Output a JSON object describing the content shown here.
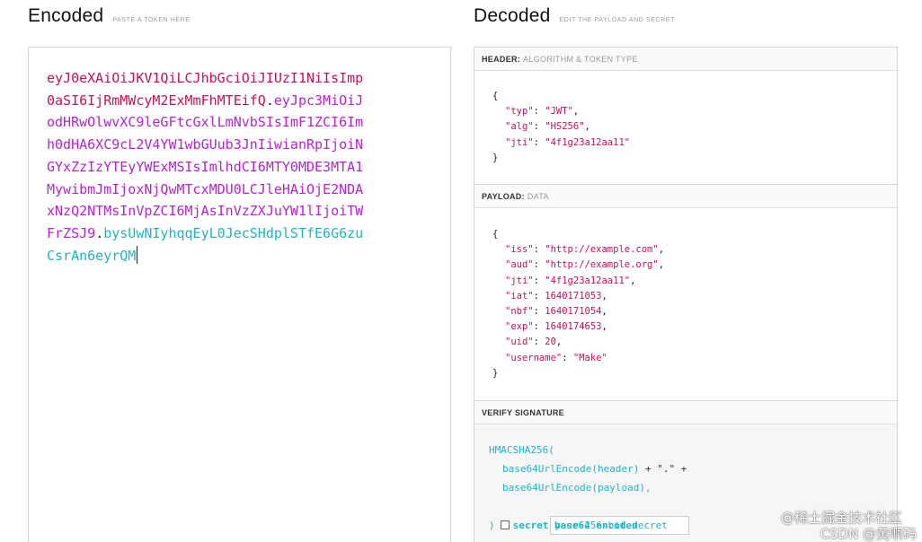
{
  "encoded": {
    "title": "Encoded",
    "hint": "PASTE A TOKEN HERE",
    "token_lines": [
      [
        {
          "t": "eyJ0eXAiOiJKV1QiLCJhbGciOiJIUzI1NiIsImp",
          "c": "header"
        }
      ],
      [
        {
          "t": "0aSI6IjRmMWcyM2ExMmFhMTEifQ",
          "c": "header"
        },
        {
          "t": ".",
          "c": "dot"
        },
        {
          "t": "eyJpc3MiOiJ",
          "c": "payload"
        }
      ],
      [
        {
          "t": "odHRwOlwvXC9leGFtcGxlLmNvbSIsImF1ZCI6Im",
          "c": "payload"
        }
      ],
      [
        {
          "t": "h0dHA6XC9cL2V4YW1wbGUub3JnIiwianRpIjoiN",
          "c": "payload"
        }
      ],
      [
        {
          "t": "GYxZzIzYTEyYWExMSIsImlhdCI6MTY0MDE3MTA1",
          "c": "payload"
        }
      ],
      [
        {
          "t": "MywibmJmIjoxNjQwMTcxMDU0LCJleHAiOjE2NDA",
          "c": "payload"
        }
      ],
      [
        {
          "t": "xNzQ2NTMsInVpZCI6MjAsInVzZXJuYW1lIjoiTW",
          "c": "payload"
        }
      ],
      [
        {
          "t": "FrZSJ9",
          "c": "payload"
        },
        {
          "t": ".",
          "c": "dot"
        },
        {
          "t": "bysUwNIyhqqEyL0JecSHdplSTfE6G6zu",
          "c": "sig"
        }
      ],
      [
        {
          "t": "CsrAn6eyrQM",
          "c": "sig"
        }
      ]
    ]
  },
  "decoded": {
    "title": "Decoded",
    "hint": "EDIT THE PAYLOAD AND SECRET",
    "header_section": {
      "label": "HEADER:",
      "sub": "ALGORITHM & TOKEN TYPE",
      "fields": [
        {
          "key": "typ",
          "value": "\"JWT\""
        },
        {
          "key": "alg",
          "value": "\"HS256\""
        },
        {
          "key": "jti",
          "value": "\"4f1g23a12aa11\""
        }
      ]
    },
    "payload_section": {
      "label": "PAYLOAD:",
      "sub": "DATA",
      "fields": [
        {
          "key": "iss",
          "value": "\"http://example.com\""
        },
        {
          "key": "aud",
          "value": "\"http://example.org\""
        },
        {
          "key": "jti",
          "value": "\"4f1g23a12aa11\""
        },
        {
          "key": "iat",
          "value": "1640171053"
        },
        {
          "key": "nbf",
          "value": "1640171054"
        },
        {
          "key": "exp",
          "value": "1640174653"
        },
        {
          "key": "uid",
          "value": "20"
        },
        {
          "key": "username",
          "value": "\"Make\""
        }
      ]
    },
    "verify_section": {
      "label": "VERIFY SIGNATURE",
      "func": "HMACSHA256(",
      "line_header": "base64UrlEncode(header)",
      "plus": " + \".\" +",
      "line_payload": "base64UrlEncode(payload),",
      "secret_placeholder": "your-256-bit-secret",
      "close": ")",
      "checkbox_label": "secret base64 encoded"
    }
  },
  "watermark": {
    "line1": "@稀土掘金技术社区",
    "line2": "CSDN @黄啊码"
  },
  "colors": {
    "header": "#d0104c",
    "payload": "#b524d0",
    "signature": "#1fb4c6"
  }
}
